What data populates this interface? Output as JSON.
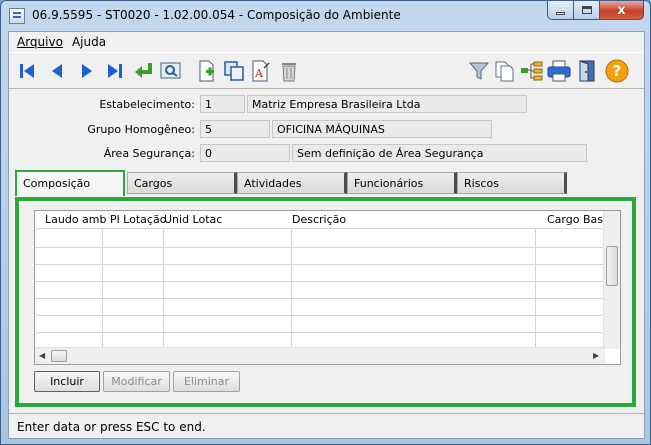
{
  "window": {
    "title": "06.9.5595 - ST0020 - 1.02.00.054 - Composição do Ambiente",
    "close_glyph": "x"
  },
  "menu": {
    "items": [
      {
        "label": "Arquivo"
      },
      {
        "label": "Ajuda"
      }
    ]
  },
  "toolbar": {
    "icons": [
      "first-record-icon",
      "previous-record-icon",
      "next-record-icon",
      "last-record-icon",
      "go-to-icon",
      "search-icon",
      "new-document-icon",
      "copy-icon",
      "rename-icon",
      "delete-icon",
      "filter-icon",
      "document-copy-icon",
      "tree-icon",
      "print-icon",
      "exit-icon",
      "help-icon"
    ]
  },
  "header": {
    "estabelecimento": {
      "label": "Estabelecimento:",
      "code": "1",
      "description": "Matriz Empresa Brasileira Ltda"
    },
    "grupo_homogeneo": {
      "label": "Grupo Homogêneo:",
      "code": "5",
      "description": "OFICINA MÁQUINAS"
    },
    "area_seguranca": {
      "label": "Área Segurança:",
      "code": "0",
      "description": "Sem definição de Área Segurança"
    }
  },
  "tabs": [
    {
      "label": "Composição",
      "active": true
    },
    {
      "label": "Cargos"
    },
    {
      "label": "Atividades"
    },
    {
      "label": "Funcionários"
    },
    {
      "label": "Riscos"
    }
  ],
  "grid": {
    "columns": [
      "Laudo amb",
      "Pl Lotação",
      "Unid Lotac",
      "Descrição",
      "Cargo Bas D"
    ],
    "rows": []
  },
  "buttons": {
    "incluir": "Incluir",
    "modificar": "Modificar",
    "eliminar": "Eliminar"
  },
  "status": {
    "text": "Enter data or press ESC to end."
  },
  "colors": {
    "focus_green": "#2aa83a",
    "nav_blue": "#1f5fd6",
    "help_orange": "#f5a10f"
  }
}
